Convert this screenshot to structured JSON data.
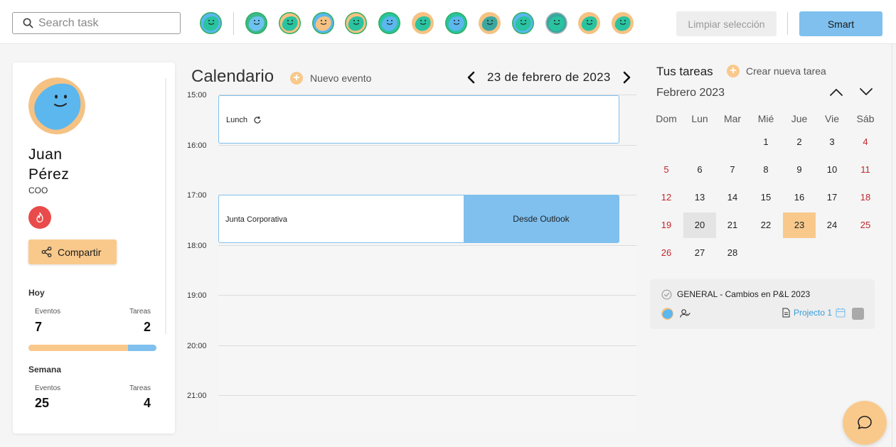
{
  "colors": {
    "accent_blue": "#7fc0ee",
    "accent_peach": "#f9c98c",
    "weekend_red": "#c0282d",
    "alert_red": "#e94b4b"
  },
  "search": {
    "placeholder": "Search task"
  },
  "team": {
    "avatars": [
      "avatar-1",
      "avatar-2",
      "avatar-3",
      "avatar-4",
      "avatar-5",
      "avatar-6",
      "avatar-7",
      "avatar-8",
      "avatar-9",
      "avatar-10",
      "avatar-11",
      "avatar-12",
      "avatar-13"
    ]
  },
  "toolbar": {
    "clear_label": "Limpiar selección",
    "smart_label": "Smart"
  },
  "profile": {
    "first_name": "Juan",
    "last_name": "Pérez",
    "role": "COO",
    "share_label": "Compartir",
    "today": {
      "title": "Hoy",
      "events_label": "Eventos",
      "events": "7",
      "tasks_label": "Tareas",
      "tasks": "2",
      "progress": 0.78
    },
    "week": {
      "title": "Semana",
      "events_label": "Eventos",
      "events": "25",
      "tasks_label": "Tareas",
      "tasks": "4"
    }
  },
  "calendar": {
    "title": "Calendario",
    "new_event_label": "Nuevo evento",
    "date": "23 de febrero de 2023",
    "hours": [
      "15:00",
      "16:00",
      "17:00",
      "18:00",
      "19:00",
      "20:00",
      "21:00"
    ],
    "events": [
      {
        "name": "Lunch",
        "recurring": true
      },
      {
        "name": "Junta Corporativa",
        "source": "Desde Outlook"
      }
    ]
  },
  "tasks": {
    "title": "Tus tareas",
    "new_task_label": "Crear nueva tarea",
    "month": "Febrero 2023",
    "weekdays": [
      "Dom",
      "Lun",
      "Mar",
      "Mié",
      "Jue",
      "Vie",
      "Sáb"
    ],
    "weeks": [
      [
        "",
        "",
        "",
        "1",
        "2",
        "3",
        "4"
      ],
      [
        "5",
        "6",
        "7",
        "8",
        "9",
        "10",
        "11"
      ],
      [
        "12",
        "13",
        "14",
        "15",
        "16",
        "17",
        "18"
      ],
      [
        "19",
        "20",
        "21",
        "22",
        "23",
        "24",
        "25"
      ],
      [
        "26",
        "27",
        "28",
        "",
        "",
        "",
        ""
      ]
    ],
    "selected_day": "20",
    "today_day": "23",
    "task": {
      "name": "GENERAL - Cambios en P&L 2023",
      "project": "Projecto 1"
    }
  }
}
